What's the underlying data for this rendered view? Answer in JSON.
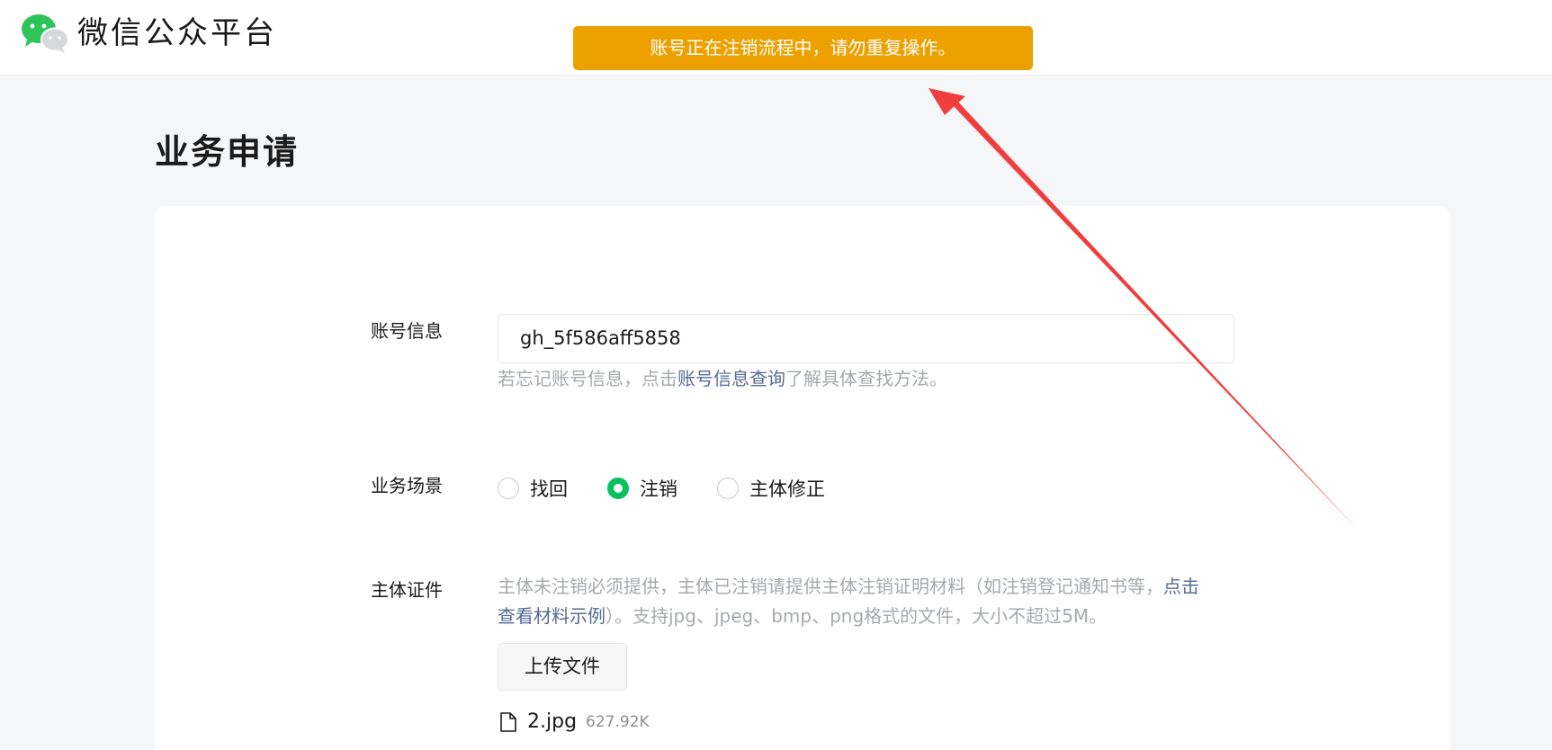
{
  "header": {
    "logo_text": "微信公众平台",
    "logo_icon": "wechat-logo-icon"
  },
  "toast": {
    "message": "账号正在注销流程中，请勿重复操作。",
    "color": "#eca100"
  },
  "page": {
    "title": "业务申请"
  },
  "form": {
    "account": {
      "label": "账号信息",
      "value": "gh_5f586aff5858",
      "hint_prefix": "若忘记账号信息，点击",
      "hint_link": "账号信息查询",
      "hint_suffix": "了解具体查找方法。"
    },
    "scene": {
      "label": "业务场景",
      "options": [
        {
          "label": "找回",
          "checked": false
        },
        {
          "label": "注销",
          "checked": true
        },
        {
          "label": "主体修正",
          "checked": false
        }
      ]
    },
    "certificate": {
      "label": "主体证件",
      "hint_prefix": "主体未注销必须提供，主体已注销请提供主体注销证明材料（如注销登记通知书等，",
      "hint_link_part1": "点击",
      "hint_link_part2": "查看材料示例",
      "hint_suffix": "）。支持jpg、jpeg、bmp、png格式的文件，大小不超过5M。",
      "upload_label": "上传文件",
      "file": {
        "name": "2.jpg",
        "size": "627.92K",
        "icon": "file-icon"
      }
    }
  },
  "colors": {
    "accent": "#07c160",
    "link": "#576b95",
    "annotation_arrow": "#f03e3e"
  }
}
